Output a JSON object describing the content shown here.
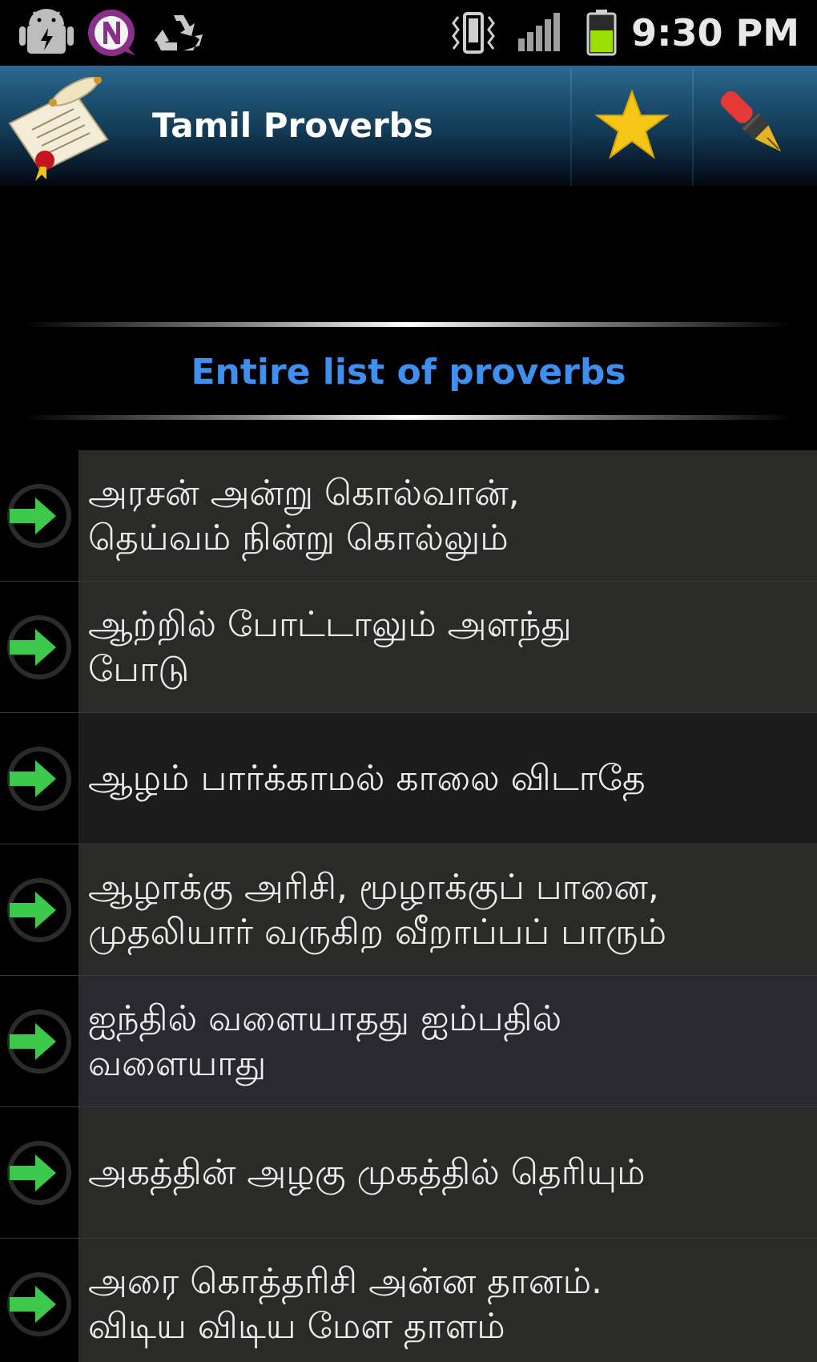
{
  "status_bar": {
    "time": "9:30 PM",
    "left_icons": [
      "android-debug-icon",
      "n-app-icon",
      "recycle-icon"
    ],
    "right_icons": [
      "vibrate-icon",
      "signal-icon",
      "battery-icon"
    ]
  },
  "action_bar": {
    "title": "Tamil Proverbs",
    "logo_icon": "scroll-icon",
    "actions": [
      {
        "icon": "star-icon",
        "color": "#f5c518"
      },
      {
        "icon": "pen-icon",
        "color": "#e53935"
      }
    ]
  },
  "section": {
    "title": "Entire list of proverbs",
    "title_color": "#3e8ff0"
  },
  "proverbs": [
    {
      "line1": "அரசன் அன்று கொல்வான்,",
      "line2": "தெய்வம் நின்று கொல்லும்"
    },
    {
      "line1": "ஆற்றில் போட்டாலும் அளந்து",
      "line2": "போடு"
    },
    {
      "line1": "ஆழம் பார்க்காமல் காலை விடாதே",
      "line2": ""
    },
    {
      "line1": "ஆழாக்கு அரிசி, மூழாக்குப் பானை,",
      "line2": "முதலியார் வருகிற வீறாப்பப் பாரும்"
    },
    {
      "line1": "ஐந்தில் வளையாதது ஐம்பதில்",
      "line2": "வளையாது"
    },
    {
      "line1": "அகத்தின் அழகு முகத்தில் தெரியும்",
      "line2": ""
    },
    {
      "line1": "அரை கொத்தரிசி அன்ன தானம்.",
      "line2": "விடிய விடிய மேள தாளம்"
    }
  ],
  "colors": {
    "arrow_green": "#3cc84a",
    "accent_blue": "#3e8ff0"
  }
}
